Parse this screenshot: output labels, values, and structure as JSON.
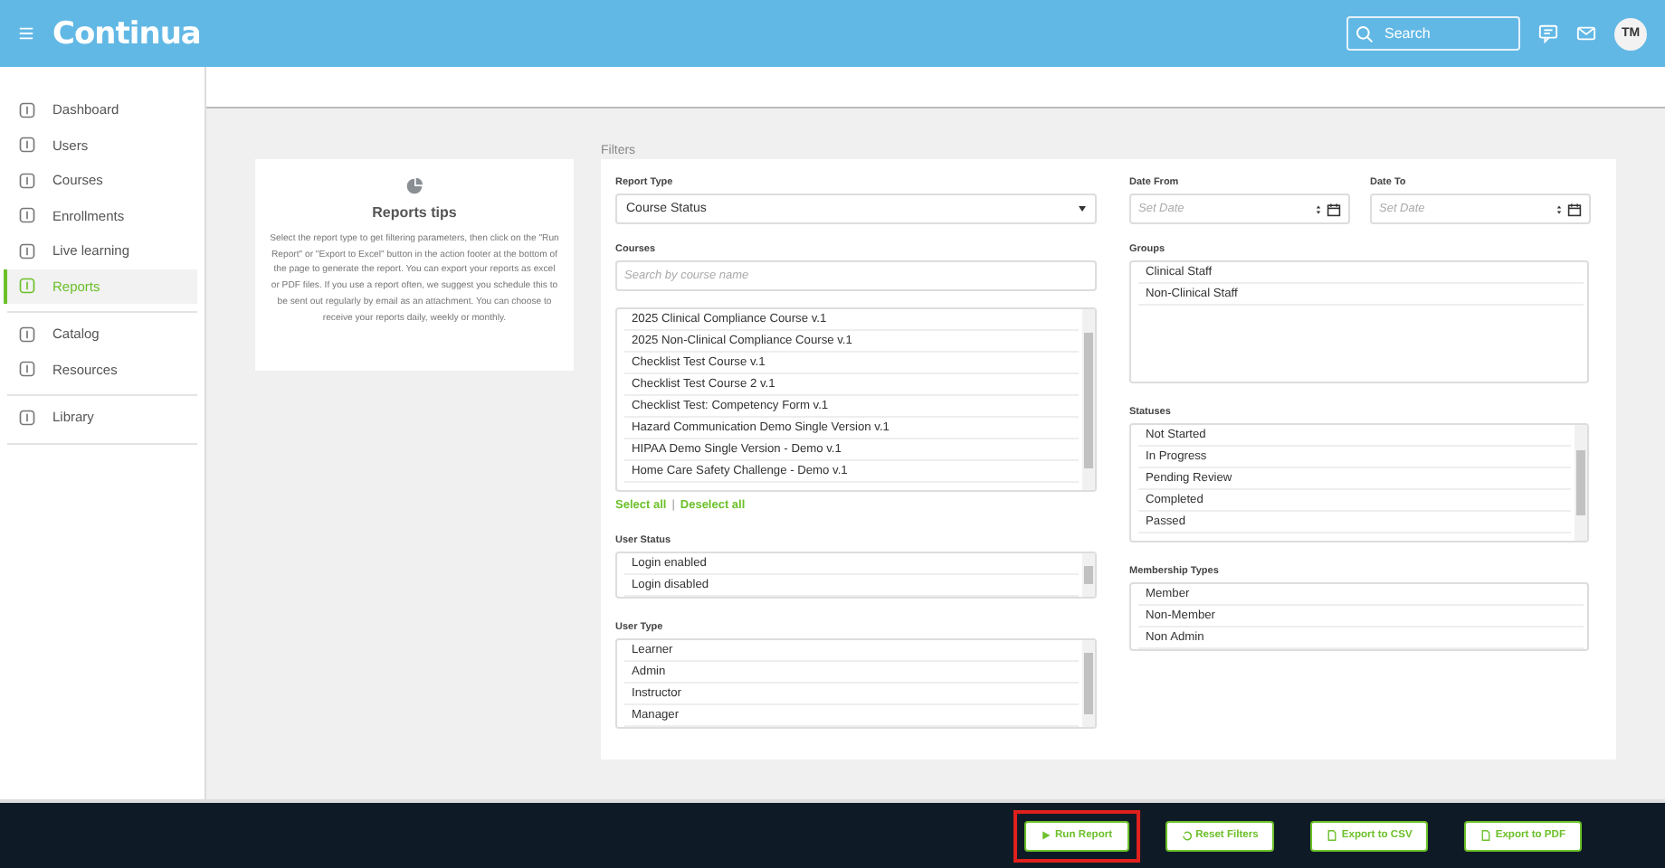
{
  "header": {
    "logo": "Continua",
    "search": {
      "placeholder": "Search"
    },
    "avatar": "TM"
  },
  "sidebar": {
    "sections": [
      [
        {
          "label": "Dashboard",
          "selected": false
        },
        {
          "label": "Users",
          "selected": false
        },
        {
          "label": "Courses",
          "selected": false
        },
        {
          "label": "Enrollments",
          "selected": false
        },
        {
          "label": "Live learning",
          "selected": false
        },
        {
          "label": "Reports",
          "selected": true
        }
      ],
      [
        {
          "label": "Catalog",
          "selected": false
        },
        {
          "label": "Resources",
          "selected": false
        }
      ],
      [
        {
          "label": "Library",
          "selected": false
        }
      ]
    ]
  },
  "tips": {
    "title": "Reports tips",
    "text": "Select the report type to get filtering parameters, then click on the \"Run Report\" or \"Export to Excel\" button in the action footer at the bottom of the page to generate the report. You can export your reports as excel or PDF files. If you use a report often, we suggest you schedule this to be sent out regularly by email as an attachment. You can choose to receive your reports daily, weekly or monthly."
  },
  "filters": {
    "title": "Filters",
    "report_type": {
      "label": "Report Type",
      "value": "Course Status"
    },
    "courses": {
      "label": "Courses",
      "placeholder": "Search by course name",
      "items": [
        "2025 Clinical Compliance Course v.1",
        "2025 Non-Clinical Compliance Course v.1",
        "Checklist Test Course v.1",
        "Checklist Test Course 2 v.1",
        "Checklist Test: Competency Form v.1",
        "Hazard Communication Demo Single Version v.1",
        "HIPAA Demo Single Version - Demo v.1",
        "Home Care Safety Challenge - Demo v.1"
      ],
      "select_all": "Select all",
      "separator": "|",
      "deselect_all": "Deselect all"
    },
    "user_status": {
      "label": "User Status",
      "items": [
        "Login enabled",
        "Login disabled"
      ]
    },
    "user_type": {
      "label": "User Type",
      "items": [
        "Learner",
        "Admin",
        "Instructor",
        "Manager"
      ]
    },
    "date_from": {
      "label": "Date From",
      "placeholder": "Set Date"
    },
    "date_to": {
      "label": "Date To",
      "placeholder": "Set Date"
    },
    "groups": {
      "label": "Groups",
      "items": [
        "Clinical Staff",
        "Non-Clinical Staff"
      ]
    },
    "statuses": {
      "label": "Statuses",
      "items": [
        "Not Started",
        "In Progress",
        "Pending Review",
        "Completed",
        "Passed"
      ]
    },
    "membership_types": {
      "label": "Membership Types",
      "items": [
        "Member",
        "Non-Member",
        "Non Admin"
      ]
    }
  },
  "footer": {
    "buttons": [
      {
        "label": "Run Report",
        "highlighted": true
      },
      {
        "label": "Reset Filters",
        "highlighted": false
      },
      {
        "label": "Export to CSV",
        "highlighted": false
      },
      {
        "label": "Export to PDF",
        "highlighted": false
      }
    ]
  }
}
